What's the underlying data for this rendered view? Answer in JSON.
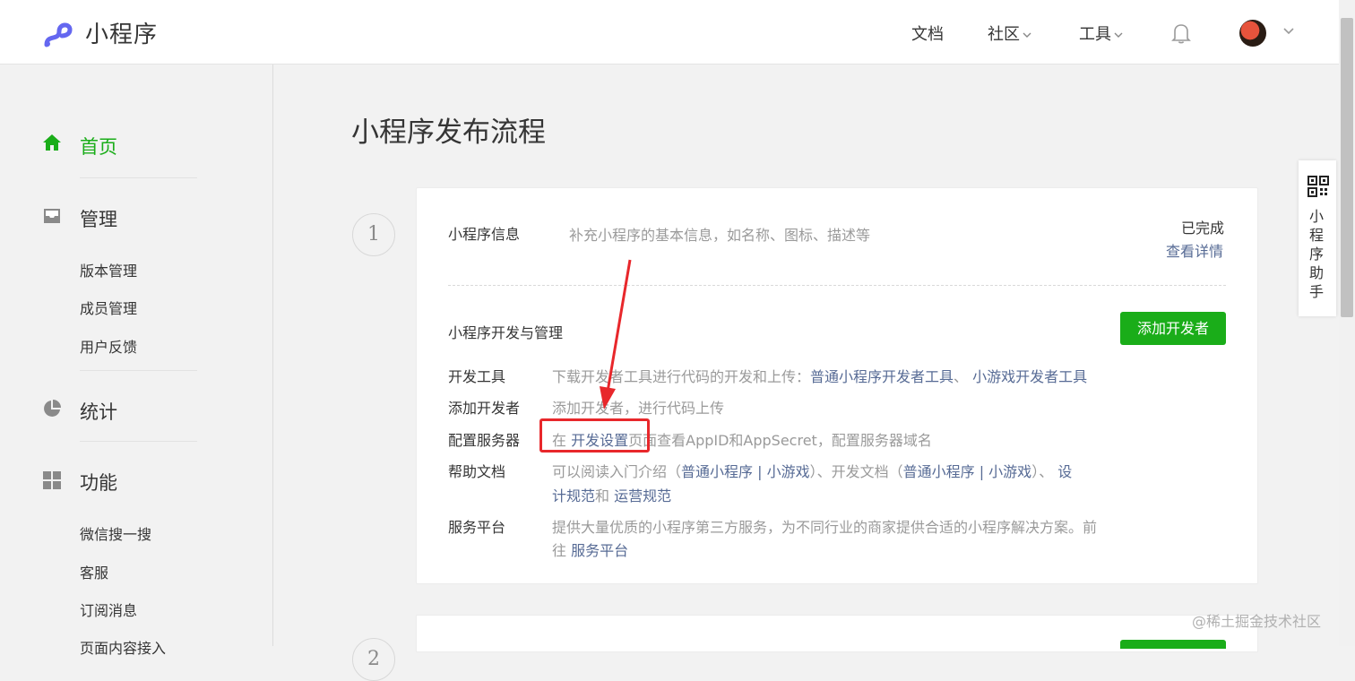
{
  "header": {
    "brand": "小程序",
    "nav": [
      {
        "label": "文档"
      },
      {
        "label": "社区"
      },
      {
        "label": "工具"
      }
    ]
  },
  "sidebar": {
    "sections": [
      {
        "label": "首页",
        "icon": "home-icon",
        "active": true
      },
      {
        "label": "管理",
        "icon": "inbox-icon",
        "items": [
          "版本管理",
          "成员管理",
          "用户反馈"
        ]
      },
      {
        "label": "统计",
        "icon": "pie-chart-icon"
      },
      {
        "label": "功能",
        "icon": "grid-icon",
        "items": [
          "微信搜一搜",
          "客服",
          "订阅消息",
          "页面内容接入"
        ]
      }
    ]
  },
  "main": {
    "title": "小程序发布流程",
    "step1": {
      "number": "1",
      "info": {
        "label": "小程序信息",
        "desc": "补充小程序的基本信息，如名称、图标、描述等",
        "status": "已完成",
        "link": "查看详情"
      },
      "dev": {
        "title": "小程序开发与管理",
        "button": "添加开发者",
        "rows": [
          {
            "label": "开发工具",
            "text": "下载开发者工具进行代码的开发和上传：",
            "link1": "普通小程序开发者工具",
            "sep": "、",
            "link2": "小游戏开发者工具"
          },
          {
            "label": "添加开发者",
            "text": "添加开发者，进行代码上传"
          },
          {
            "label": "配置服务器",
            "pre": "在",
            "link": "开发设置",
            "post": "页面查看AppID和AppSecret，配置服务器域名"
          },
          {
            "label": "帮助文档",
            "t1": "可以阅读入门介绍（",
            "l1": "普通小程序 | 小游戏",
            "t2": "）、开发文档（",
            "l2": "普通小程序 | 小游戏",
            "t3": "）、",
            "l3a": "设",
            "l3b": "计规范",
            "t4": "和",
            "l4": "运营规范"
          },
          {
            "label": "服务平台",
            "t1": "提供大量优质的小程序第三方服务，为不同行业的商家提供合适的小程序解决方案。前",
            "t2": "往",
            "link": "服务平台"
          }
        ]
      }
    },
    "step2": {
      "number": "2"
    }
  },
  "helper": {
    "label": "小程序助手"
  },
  "watermark": "@稀土掘金技术社区",
  "colors": {
    "accent": "#1aad19",
    "link": "#576b95",
    "highlight": "#e8272b"
  }
}
